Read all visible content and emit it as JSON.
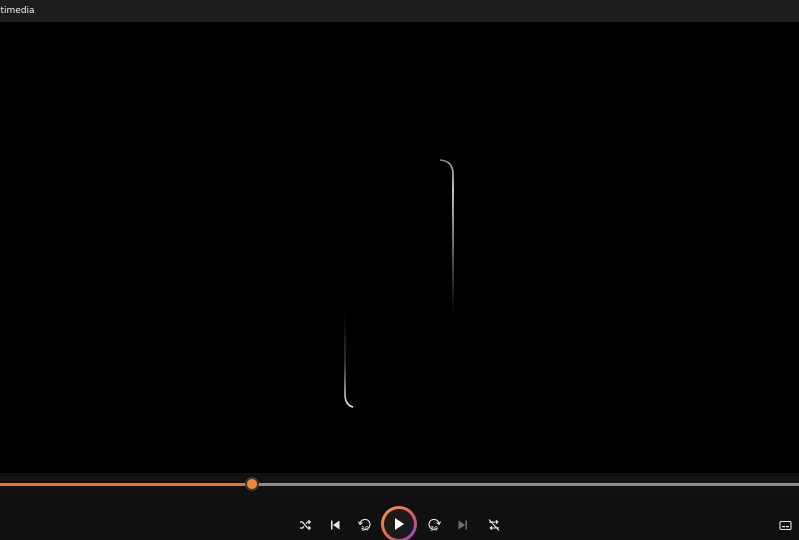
{
  "window": {
    "title": "ltimedia"
  },
  "playback": {
    "progress_fraction": 0.315,
    "state": "paused"
  },
  "controls": {
    "shuffle_icon": "shuffle-icon",
    "previous_icon": "previous-track-icon",
    "skip_back_icon": "skip-back-10-icon",
    "skip_back_label": "10",
    "play_icon": "play-icon",
    "skip_forward_icon": "skip-forward-30-icon",
    "skip_forward_label": "30",
    "next_icon": "next-track-icon",
    "repeat_icon": "repeat-off-icon",
    "captions_icon": "captions-icon"
  },
  "colors": {
    "accent": "#e8752d",
    "play_ring_start": "#f6a03c",
    "play_ring_end": "#8b3fd6",
    "titlebar": "#1d1d1d",
    "background": "#000000"
  }
}
